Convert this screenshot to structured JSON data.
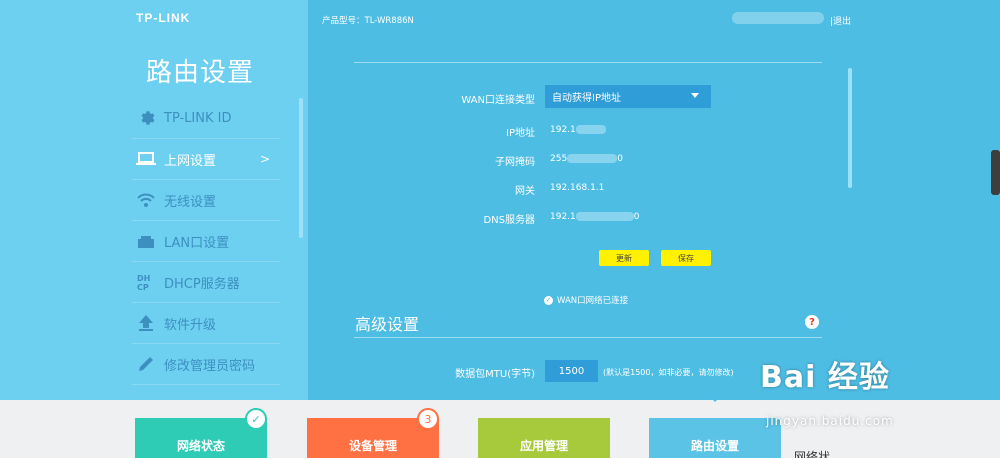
{
  "brand": "TP-LINK",
  "sidebar": {
    "title": "路由设置",
    "items": [
      {
        "label": "TP-LINK ID",
        "icon": "gear-icon"
      },
      {
        "label": "上网设置",
        "icon": "laptop-icon",
        "chevron": ">"
      },
      {
        "label": "无线设置",
        "icon": "wifi-icon"
      },
      {
        "label": "LAN口设置",
        "icon": "lan-icon"
      },
      {
        "label": "DHCP服务器",
        "icon": "dhcp-icon"
      },
      {
        "label": "软件升级",
        "icon": "upload-icon"
      },
      {
        "label": "修改管理员密码",
        "icon": "pencil-icon"
      }
    ]
  },
  "topbar": {
    "model": "产品型号：TL-WR886N",
    "logout": "|退出"
  },
  "wan": {
    "type_label": "WAN口连接类型",
    "type_value": "自动获得IP地址",
    "ip_label": "IP地址",
    "ip_value": "192.1",
    "mask_label": "子网掩码",
    "mask_value": "255",
    "mask_suffix": "0",
    "gateway_label": "网关",
    "gateway_value": "192.168.1.1",
    "dns_label": "DNS服务器",
    "dns_value": "192.1",
    "dns_suffix": "0",
    "refresh_button": "更新",
    "save_button": "保存",
    "status": "WAN口网络已连接"
  },
  "advanced": {
    "title": "高级设置",
    "help": "?",
    "mtu_label": "数据包MTU(字节)",
    "mtu_value": "1500",
    "mtu_hint": "(默认是1500，如非必要，请勿修改)"
  },
  "tabs": [
    {
      "label": "网络状态",
      "color": "#2ecbb5",
      "badge": "✓"
    },
    {
      "label": "设备管理",
      "color": "#ff7043",
      "badge": "3"
    },
    {
      "label": "应用管理",
      "color": "#a7c93c"
    },
    {
      "label": "路由设置",
      "color": "#5bc3e6"
    }
  ],
  "watermark": {
    "brand": "Bai 经验",
    "url": "jingyan.baidu.com"
  },
  "bottom_cut": "网络状"
}
